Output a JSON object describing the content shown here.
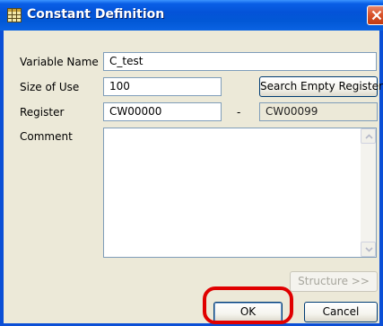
{
  "window": {
    "title": "Constant Definition",
    "icon": "table-grid-icon",
    "close_icon": "close-icon"
  },
  "form": {
    "variable_name": {
      "label": "Variable Name",
      "value": "C_test"
    },
    "size_of_use": {
      "label": "Size of Use",
      "value": "100"
    },
    "search_button": "Search Empty Register",
    "register": {
      "label": "Register",
      "value": "CW00000",
      "separator": "-",
      "end_value": "CW00099"
    },
    "comment": {
      "label": "Comment",
      "value": ""
    }
  },
  "buttons": {
    "structure": "Structure >>",
    "ok": "OK",
    "cancel": "Cancel"
  },
  "colors": {
    "titlebar": "#0453d8",
    "dialog_bg": "#ece9d8",
    "highlight_ring": "#e00000"
  }
}
